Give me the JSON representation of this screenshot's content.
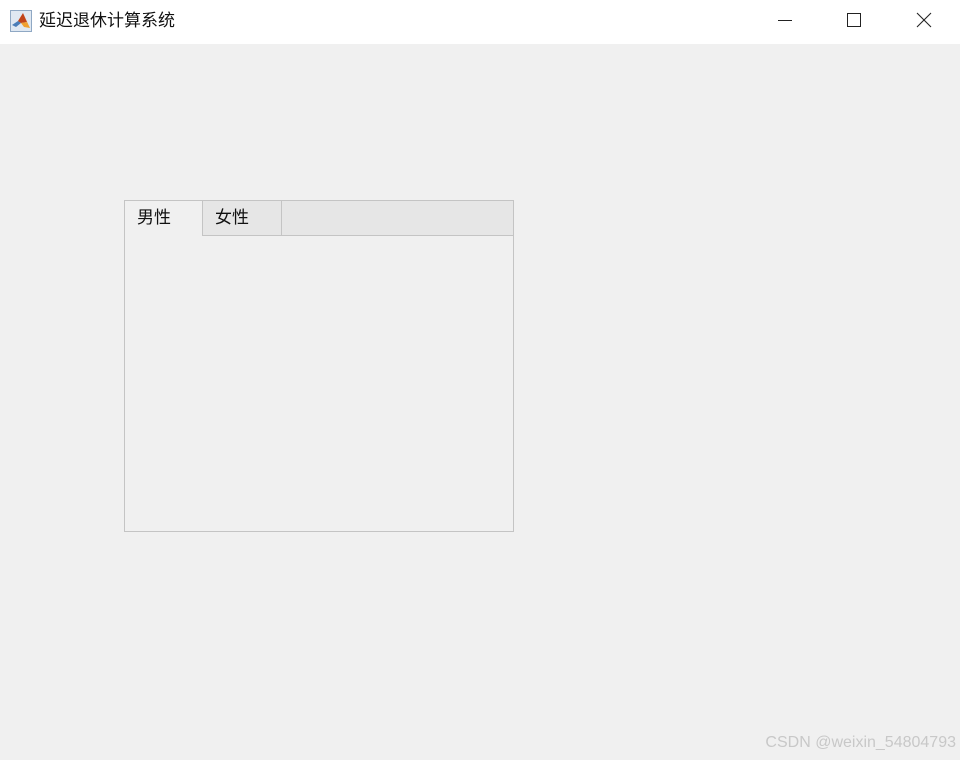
{
  "window": {
    "title": "延迟退休计算系统",
    "app_icon": "matlab-logo-icon",
    "controls": {
      "minimize_icon": "minimize-icon",
      "maximize_icon": "maximize-icon",
      "close_icon": "close-icon"
    }
  },
  "tabgroup": {
    "tabs": [
      {
        "label": "男性",
        "selected": true
      },
      {
        "label": "女性",
        "selected": false
      }
    ]
  },
  "watermark": {
    "text": "CSDN @weixin_54804793"
  },
  "colors": {
    "background": "#f0f0f0",
    "titlebar": "#ffffff",
    "tab_border": "#c4c4c4",
    "tabstrip": "#e6e6e6"
  }
}
